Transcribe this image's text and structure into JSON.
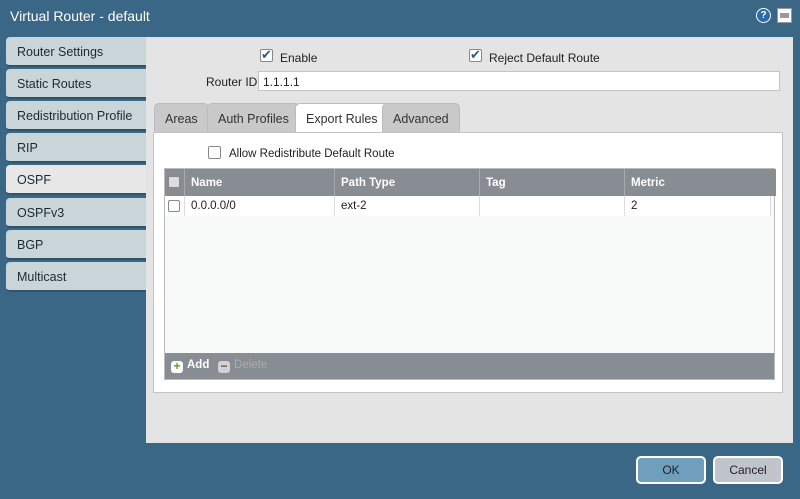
{
  "window": {
    "title": "Virtual Router - default",
    "help_icon": "question-circle-icon",
    "maximize_icon": "window-icon"
  },
  "sidebar": {
    "items": [
      {
        "label": "Router Settings"
      },
      {
        "label": "Static Routes"
      },
      {
        "label": "Redistribution Profile"
      },
      {
        "label": "RIP"
      },
      {
        "label": "OSPF",
        "active": true
      },
      {
        "label": "OSPFv3"
      },
      {
        "label": "BGP"
      },
      {
        "label": "Multicast"
      }
    ]
  },
  "form": {
    "enable_label": "Enable",
    "enable_checked": true,
    "reject_label": "Reject Default Route",
    "reject_checked": true,
    "router_id_label": "Router ID",
    "router_id_value": "1.1.1.1"
  },
  "tabs": [
    {
      "label": "Areas"
    },
    {
      "label": "Auth Profiles"
    },
    {
      "label": "Export Rules",
      "active": true
    },
    {
      "label": "Advanced"
    }
  ],
  "export": {
    "allow_label": "Allow Redistribute Default Route",
    "allow_checked": false,
    "columns": [
      "Name",
      "Path Type",
      "Tag",
      "Metric"
    ],
    "rows": [
      {
        "name": "0.0.0.0/0",
        "path_type": "ext-2",
        "tag": "",
        "metric": "2"
      }
    ],
    "add_label": "Add",
    "delete_label": "Delete"
  },
  "buttons": {
    "ok": "OK",
    "cancel": "Cancel"
  },
  "colors": {
    "background": "#3b6787",
    "ok": "#6f9fbd",
    "cancel": "#c0c5cc",
    "header": "#878d93"
  }
}
